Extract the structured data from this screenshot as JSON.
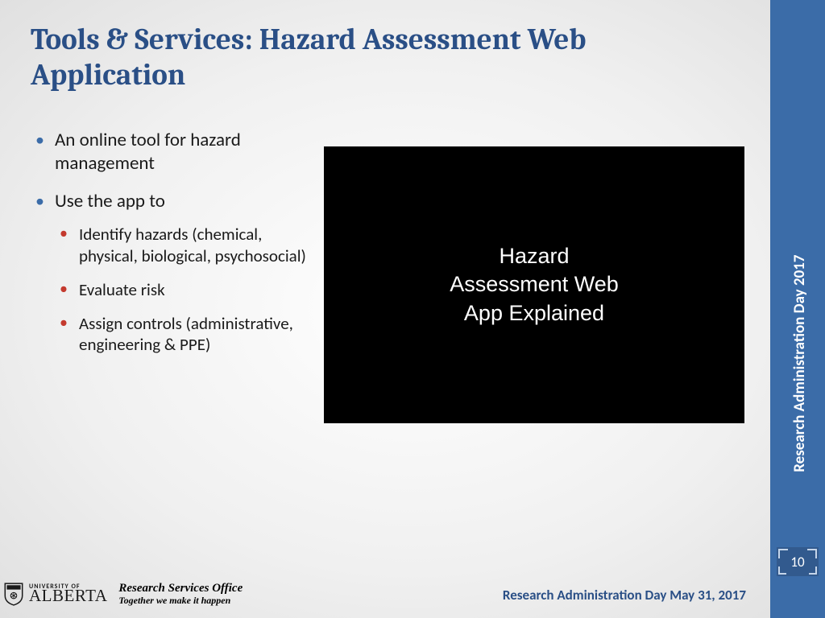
{
  "title": "Tools & Services: Hazard Assessment  Web Application",
  "bullets": {
    "b1": "An online tool for hazard management",
    "b2": "Use the app to",
    "sub1": "Identify hazards (chemical, physical, biological, psychosocial)",
    "sub2": "Evaluate risk",
    "sub3": "Assign controls (administrative, engineering & PPE)"
  },
  "video_text": "Hazard\nAssessment Web\nApp Explained",
  "sidebar_label": "Research Administration Day 2017",
  "page_number": "10",
  "logo": {
    "small": "UNIVERSITY OF",
    "big": "ALBERTA"
  },
  "office": {
    "title": "Research Services Office",
    "tagline": "Together we make it happen"
  },
  "footer_right": "Research Administration Day May 31, 2017"
}
